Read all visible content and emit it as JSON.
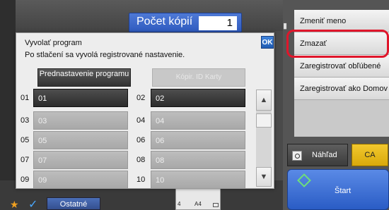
{
  "header": {
    "copies_label": "Počet kópií",
    "copies_value": "1"
  },
  "right_menu": {
    "items": [
      "Zmeniť meno",
      "Zmazať",
      "Zaregistrovať obľúbené",
      "Zaregistrovať ako Domov"
    ],
    "preview_label": "Náhľad",
    "ca_label": "CA",
    "start_label": "Štart"
  },
  "bottom": {
    "others_label": "Ostatné",
    "paper_count": "4",
    "paper_size": "A4"
  },
  "dialog": {
    "title": "Vyvolať program",
    "subtitle": "Po stlačení sa vyvolá registrované nastavenie.",
    "ok_label": "OK",
    "preset_label": "Prednastavenie programu",
    "copy_id_label": "Kópir. ID Karty",
    "programs": [
      {
        "num": "01",
        "label": "01",
        "active": true
      },
      {
        "num": "02",
        "label": "02",
        "active": true
      },
      {
        "num": "03",
        "label": "03",
        "active": false
      },
      {
        "num": "04",
        "label": "04",
        "active": false
      },
      {
        "num": "05",
        "label": "05",
        "active": false
      },
      {
        "num": "06",
        "label": "06",
        "active": false
      },
      {
        "num": "07",
        "label": "07",
        "active": false
      },
      {
        "num": "08",
        "label": "08",
        "active": false
      },
      {
        "num": "09",
        "label": "09",
        "active": false
      },
      {
        "num": "10",
        "label": "10",
        "active": false
      }
    ],
    "scroll_up_icon": "up-triangle-icon",
    "scroll_down_icon": "down-triangle-icon"
  },
  "colors": {
    "highlight": "#e0162b",
    "accent": "#2f5bbf",
    "ca": "#f2c82e"
  }
}
